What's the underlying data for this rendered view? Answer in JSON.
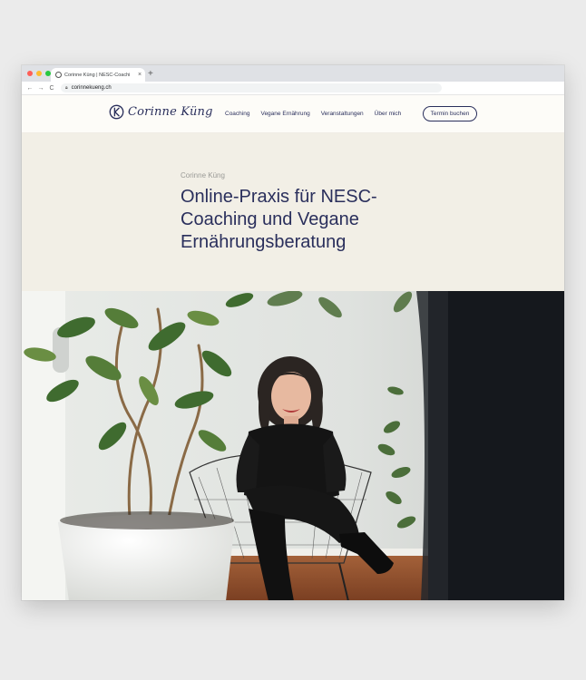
{
  "browser": {
    "tab_title": "Corinne Küng | NESC-Coachi",
    "tab_close": "×",
    "new_tab": "+",
    "url": "corinnekueng.ch",
    "back": "←",
    "forward": "→",
    "reload": "C"
  },
  "site": {
    "logo_text": "Corinne Küng",
    "nav": [
      "Coaching",
      "Vegane Ernährung",
      "Veranstaltungen",
      "Über mich"
    ],
    "cta": "Termin buchen"
  },
  "hero": {
    "eyebrow": "Corinne Küng",
    "headline_lines": [
      "Online-Praxis für NESC-",
      "Coaching und Vegane",
      "Ernährungsberatung"
    ]
  },
  "colors": {
    "brand_navy": "#2a2f5c",
    "hero_bg": "#f2efe6",
    "header_bg": "#fdfcf8"
  }
}
